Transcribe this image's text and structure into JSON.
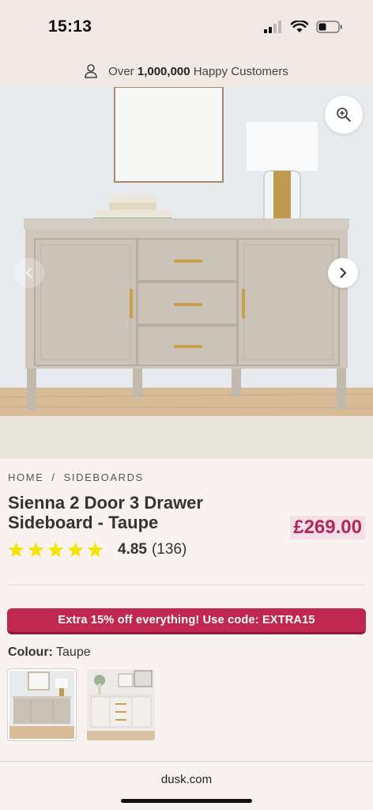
{
  "status": {
    "time": "15:13"
  },
  "promo": {
    "prefix": "Over",
    "highlight": "1,000,000",
    "suffix": "Happy Customers"
  },
  "breadcrumb": {
    "home": "HOME",
    "separator": "/",
    "category": "SIDEBOARDS"
  },
  "product": {
    "title": "Sienna 2 Door 3 Drawer Sideboard - Taupe",
    "price": "£269.00",
    "rating": {
      "value": "4.85",
      "count": "(136)",
      "stars": 5
    }
  },
  "discount": {
    "text": "Extra 15% off everything! Use code: EXTRA15"
  },
  "colour": {
    "label": "Colour:",
    "value": "Taupe"
  },
  "browser": {
    "url": "dusk.com"
  },
  "colors": {
    "accent": "#c1284f",
    "price": "#b0285a",
    "star": "#f3e500",
    "taupe": "#cfc6bc"
  }
}
